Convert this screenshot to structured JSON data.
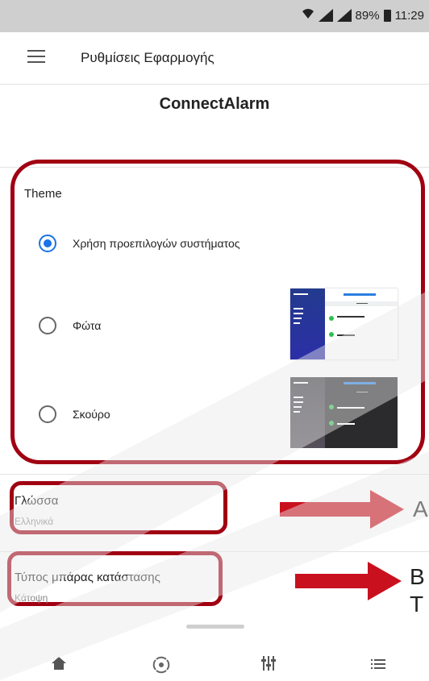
{
  "status_bar": {
    "battery_text": "89%",
    "time": "11:29"
  },
  "app_bar": {
    "title": "Ρυθμίσεις Εφαρμογής"
  },
  "subtitle": "ConnectAlarm",
  "theme": {
    "label": "Theme",
    "selected": "system",
    "options": [
      {
        "id": "system",
        "label": "Χρήση προεπιλογών συστήματος"
      },
      {
        "id": "light",
        "label": "Φώτα"
      },
      {
        "id": "dark",
        "label": "Σκούρο"
      }
    ]
  },
  "language": {
    "title": "Γλώσσα",
    "value": "Ελληνικά"
  },
  "status_bar_type": {
    "title": "Τύπος μπάρας κατάστασης",
    "value": "Κάτοψη"
  },
  "callouts": {
    "a": "A",
    "b1": "B",
    "b2": "T"
  },
  "colors": {
    "accent": "#1a73e8",
    "annotation_red": "#a00012",
    "arrow_red": "#c9101e"
  },
  "bottom_nav_icons": [
    "home-icon",
    "radar-icon",
    "sliders-icon",
    "list-icon"
  ]
}
